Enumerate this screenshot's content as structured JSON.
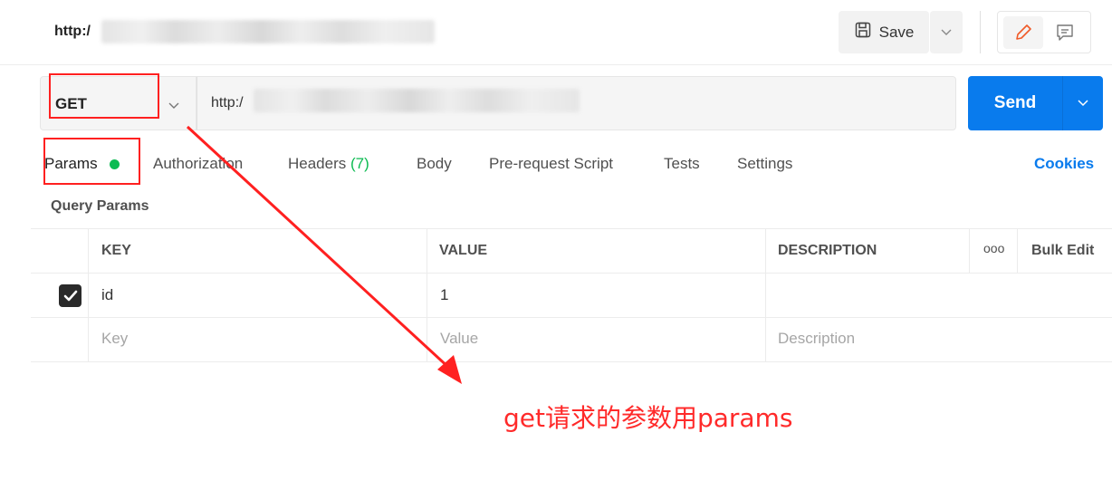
{
  "header": {
    "tab_title": "http:/",
    "save_label": "Save"
  },
  "request": {
    "method": "GET",
    "url": "http:/",
    "send_label": "Send"
  },
  "tabs": [
    {
      "label": "Params"
    },
    {
      "label": "Authorization"
    },
    {
      "label": "Headers",
      "count": "(7)"
    },
    {
      "label": "Body"
    },
    {
      "label": "Pre-request Script"
    },
    {
      "label": "Tests"
    },
    {
      "label": "Settings"
    }
  ],
  "cookies_label": "Cookies",
  "query_params": {
    "title": "Query Params",
    "columns": {
      "key": "KEY",
      "value": "VALUE",
      "description": "DESCRIPTION",
      "more": "ooo",
      "bulk_edit": "Bulk Edit"
    },
    "rows": [
      {
        "checked": true,
        "key": "id",
        "value": "1",
        "description": ""
      }
    ],
    "placeholders": {
      "key": "Key",
      "value": "Value",
      "description": "Description"
    }
  },
  "annotation": {
    "text": "get请求的参数用params",
    "color": "#ff2a2a"
  },
  "colors": {
    "send": "#097bed",
    "accent_green": "#0cbb52",
    "cookies": "#097bed"
  }
}
